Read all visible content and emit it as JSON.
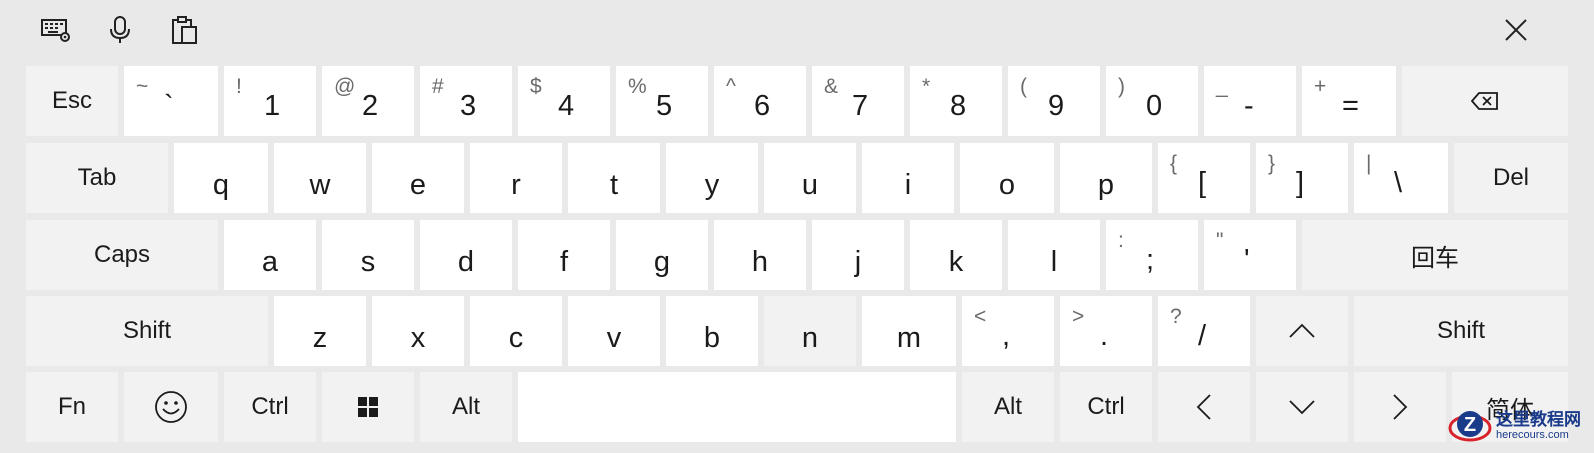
{
  "toolbar": {
    "icons": [
      "keyboard-settings-icon",
      "microphone-icon",
      "clipboard-icon",
      "close-icon"
    ]
  },
  "row1": {
    "esc": "Esc",
    "k1": {
      "shift": "~",
      "main": "`"
    },
    "k2": {
      "shift": "!",
      "main": "1"
    },
    "k3": {
      "shift": "@",
      "main": "2"
    },
    "k4": {
      "shift": "#",
      "main": "3"
    },
    "k5": {
      "shift": "$",
      "main": "4"
    },
    "k6": {
      "shift": "%",
      "main": "5"
    },
    "k7": {
      "shift": "^",
      "main": "6"
    },
    "k8": {
      "shift": "&",
      "main": "7"
    },
    "k9": {
      "shift": "*",
      "main": "8"
    },
    "k10": {
      "shift": "(",
      "main": "9"
    },
    "k11": {
      "shift": ")",
      "main": "0"
    },
    "k12": {
      "shift": "_",
      "main": "-"
    },
    "k13": {
      "shift": "+",
      "main": "="
    },
    "backspace_icon": "backspace-icon"
  },
  "row2": {
    "tab": "Tab",
    "letters": [
      "q",
      "w",
      "e",
      "r",
      "t",
      "y",
      "u",
      "i",
      "o",
      "p"
    ],
    "k_lbracket": {
      "shift": "{",
      "main": "["
    },
    "k_rbracket": {
      "shift": "}",
      "main": "]"
    },
    "k_backslash": {
      "shift": "|",
      "main": "\\"
    },
    "del": "Del"
  },
  "row3": {
    "caps": "Caps",
    "letters": [
      "a",
      "s",
      "d",
      "f",
      "g",
      "h",
      "j",
      "k",
      "l"
    ],
    "k_semicolon": {
      "shift": ":",
      "main": ";"
    },
    "k_quote": {
      "shift": "\"",
      "main": "'"
    },
    "enter": "回车"
  },
  "row4": {
    "shift_left": "Shift",
    "letters": [
      "z",
      "x",
      "c",
      "v",
      "b",
      "n",
      "m"
    ],
    "k_comma": {
      "shift": "<",
      "main": ","
    },
    "k_period": {
      "shift": ">",
      "main": "."
    },
    "k_slash": {
      "shift": "?",
      "main": "/"
    },
    "up_icon": "chevron-up-icon",
    "shift_right": "Shift"
  },
  "row5": {
    "fn": "Fn",
    "emoji_icon": "smiley-icon",
    "ctrl_left": "Ctrl",
    "win_icon": "windows-icon",
    "alt_left": "Alt",
    "alt_right": "Alt",
    "ctrl_right": "Ctrl",
    "left_icon": "chevron-left-icon",
    "down_icon": "chevron-down-icon",
    "right_icon": "chevron-right-icon",
    "last_key": "简体"
  },
  "watermark": {
    "cn": "这里教程网",
    "en": "herecours.com",
    "logo_letter": "Z"
  },
  "colors": {
    "key_light": "#ffffff",
    "key_dark": "#f2f2f2",
    "background": "#e9e9e9",
    "text": "#1b1b1b",
    "secondary_text": "#6b6b6b",
    "watermark_blue": "#1a3a8a",
    "watermark_red": "#d9232a"
  }
}
